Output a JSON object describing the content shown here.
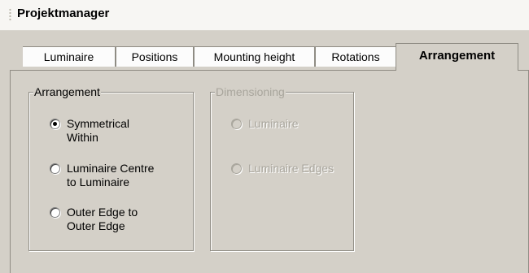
{
  "window": {
    "title": "Projektmanager"
  },
  "tabs": [
    {
      "label": "Luminaire",
      "active": false
    },
    {
      "label": "Positions",
      "active": false
    },
    {
      "label": "Mounting height",
      "active": false
    },
    {
      "label": "Rotations",
      "active": false
    },
    {
      "label": "Arrangement",
      "active": true
    }
  ],
  "arrangement_group": {
    "label": "Arrangement",
    "options": [
      {
        "label": "Symmetrical\nWithin",
        "checked": true
      },
      {
        "label": "Luminaire Centre\nto Luminaire",
        "checked": false
      },
      {
        "label": "Outer Edge to\nOuter Edge",
        "checked": false
      }
    ]
  },
  "dimensioning_group": {
    "label": "Dimensioning",
    "enabled": false,
    "options": [
      {
        "label": "Luminaire",
        "checked": false
      },
      {
        "label": "Luminaire Edges",
        "checked": false
      }
    ]
  },
  "colors": {
    "panel": "#d4d0c8",
    "titlebar": "#f7f6f3",
    "disabled_text": "#a8a59c"
  }
}
